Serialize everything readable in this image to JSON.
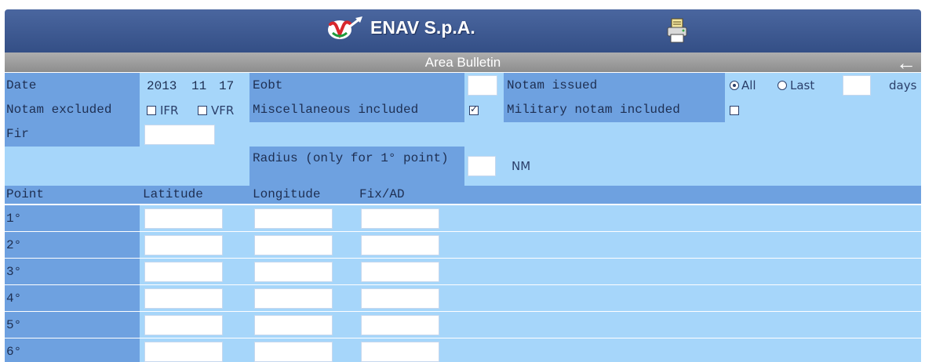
{
  "header": {
    "brand": "ENAV S.p.A."
  },
  "page": {
    "title": "Area Bulletin"
  },
  "form": {
    "date_label": "Date",
    "date_year": "2013",
    "date_month": "11",
    "date_day": "17",
    "eobt_label": "Eobt",
    "eobt_value": "",
    "notam_issued_label": "Notam issued",
    "radio_all_label": "All",
    "radio_last_label": "Last",
    "selected_radio": "All",
    "last_days_value": "",
    "days_label": "days",
    "notam_excluded_label": "Notam excluded",
    "ifr_label": "IFR",
    "ifr_checked": false,
    "vfr_label": "VFR",
    "vfr_checked": false,
    "misc_label": "Miscellaneous included",
    "misc_checked": true,
    "military_label": "Military notam included",
    "military_checked": false,
    "fir_label": "Fir",
    "fir_value": "",
    "radius_label": "Radius (only for 1° point)",
    "radius_value": "",
    "radius_unit": "NM"
  },
  "points": {
    "headers": {
      "point": "Point",
      "latitude": "Latitude",
      "longitude": "Longitude",
      "fix": "Fix/AD"
    },
    "rows": [
      {
        "label": "1°",
        "latitude": "",
        "longitude": "",
        "fix": ""
      },
      {
        "label": "2°",
        "latitude": "",
        "longitude": "",
        "fix": ""
      },
      {
        "label": "3°",
        "latitude": "",
        "longitude": "",
        "fix": ""
      },
      {
        "label": "4°",
        "latitude": "",
        "longitude": "",
        "fix": ""
      },
      {
        "label": "5°",
        "latitude": "",
        "longitude": "",
        "fix": ""
      },
      {
        "label": "6°",
        "latitude": "",
        "longitude": "",
        "fix": ""
      }
    ]
  },
  "colors": {
    "header": "#3f5b95",
    "label_cell": "#6ea1e0",
    "field_cell": "#a6d6fa",
    "logo_red": "#d8262c",
    "logo_green": "#1e9a3c"
  },
  "icons": {
    "logo": "enav-logo-icon",
    "printer": "printer-icon",
    "back": "back-arrow-icon"
  }
}
